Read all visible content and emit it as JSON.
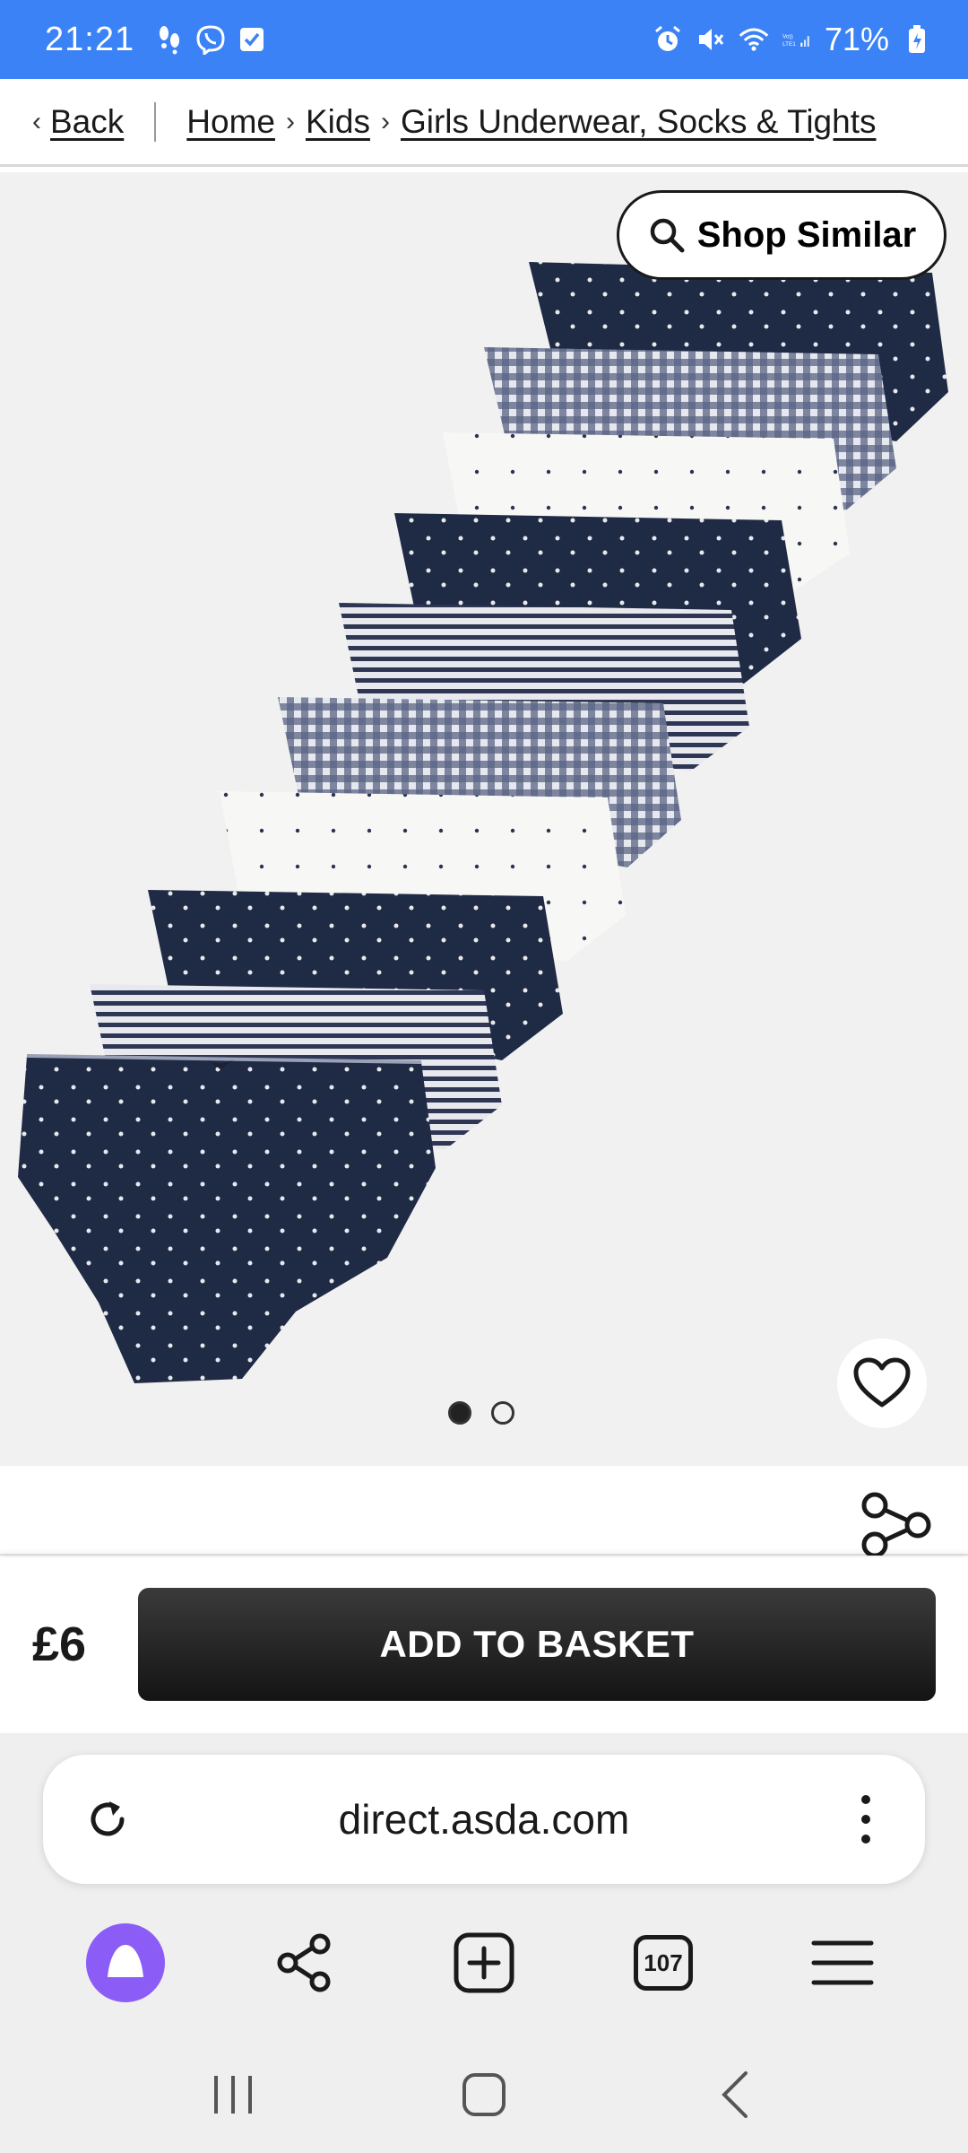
{
  "status_bar": {
    "time": "21:21",
    "battery": "71%"
  },
  "breadcrumb": {
    "back": "Back",
    "items": [
      "Home",
      "Kids",
      "Girls Underwear, Socks & Tights"
    ]
  },
  "product": {
    "shop_similar_label": "Shop Similar",
    "image_count": 2,
    "active_image_index": 0
  },
  "purchase": {
    "price": "£6",
    "add_to_basket_label": "ADD TO BASKET"
  },
  "browser": {
    "url": "direct.asda.com",
    "tab_count": "107"
  },
  "colors": {
    "status_bar_bg": "#3b82f6",
    "assistant_purple": "#8b5cf6",
    "button_dark": "#1a1a1a"
  }
}
